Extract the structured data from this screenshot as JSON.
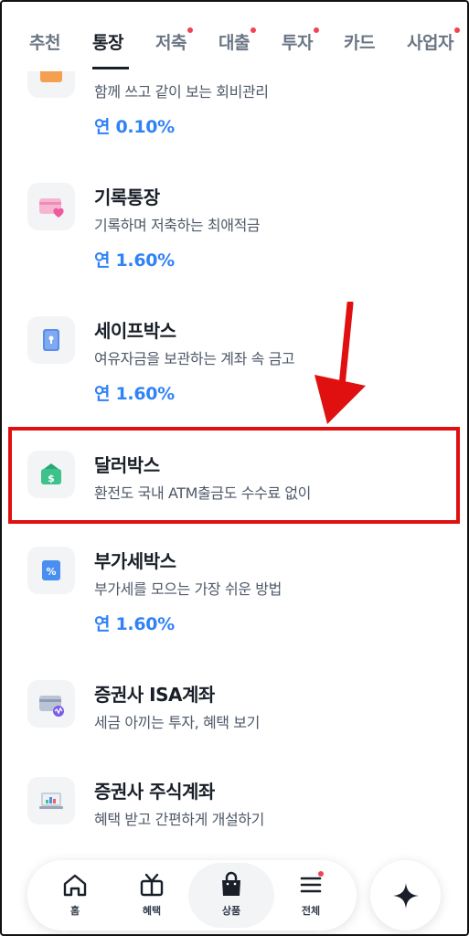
{
  "tabs": [
    {
      "label": "추천",
      "active": false,
      "dot": false
    },
    {
      "label": "통장",
      "active": true,
      "dot": false
    },
    {
      "label": "저축",
      "active": false,
      "dot": true
    },
    {
      "label": "대출",
      "active": false,
      "dot": true
    },
    {
      "label": "투자",
      "active": false,
      "dot": true
    },
    {
      "label": "카드",
      "active": false,
      "dot": false
    },
    {
      "label": "사업자",
      "active": false,
      "dot": true
    }
  ],
  "products": [
    {
      "icon": "wallet-icon",
      "title": "",
      "desc": "함께 쓰고 같이 보는 회비관리",
      "rate": "연 0.10%"
    },
    {
      "icon": "card-heart-icon",
      "title": "기록통장",
      "desc": "기록하며 저축하는 최애적금",
      "rate": "연 1.60%"
    },
    {
      "icon": "safe-box-icon",
      "title": "세이프박스",
      "desc": "여유자금을 보관하는 계좌 속 금고",
      "rate": "연 1.60%"
    },
    {
      "icon": "dollar-box-icon",
      "title": "달러박스",
      "desc": "환전도 국내 ATM출금도 수수료 없이",
      "rate": ""
    },
    {
      "icon": "percent-icon",
      "title": "부가세박스",
      "desc": "부가세를 모으는 가장 쉬운 방법",
      "rate": "연 1.60%"
    },
    {
      "icon": "card-chart-icon",
      "title": "증권사 ISA계좌",
      "desc": "세금 아끼는 투자, 혜택 보기",
      "rate": ""
    },
    {
      "icon": "laptop-chart-icon",
      "title": "증권사 주식계좌",
      "desc": "혜택 받고 간편하게 개설하기",
      "rate": ""
    }
  ],
  "bottom_nav": {
    "items": [
      {
        "label": "홈",
        "icon": "home-icon"
      },
      {
        "label": "혜택",
        "icon": "gift-icon"
      },
      {
        "label": "상품",
        "icon": "shopping-bag-icon",
        "active": true
      },
      {
        "label": "전체",
        "icon": "menu-icon",
        "dot": true
      }
    ],
    "fab_icon": "sparkle-icon"
  },
  "colors": {
    "accent": "#3182f6",
    "highlight": "#e01010",
    "text": "#191f28",
    "subtext": "#4e5968",
    "dot": "#f04452"
  }
}
